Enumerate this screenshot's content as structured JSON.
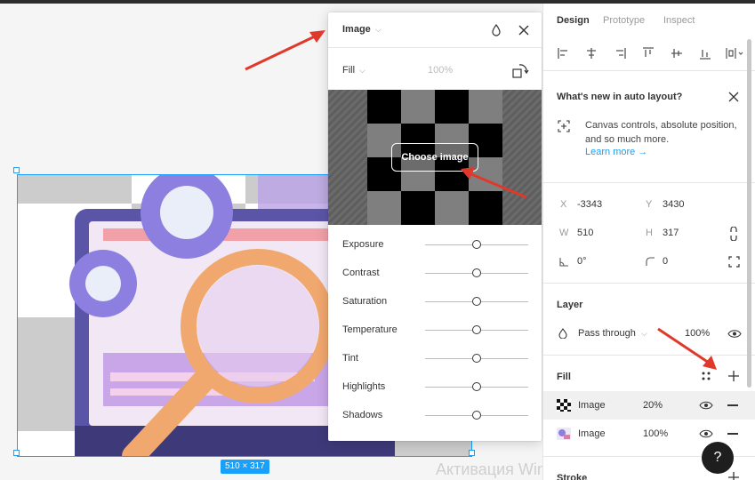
{
  "canvas": {
    "selection_size": "510 × 317",
    "watermark": "Активация Windows"
  },
  "image_popup": {
    "title": "Image",
    "fill_mode": "Fill",
    "opacity": "100%",
    "choose_button": "Choose image",
    "adjustments": [
      {
        "label": "Exposure",
        "value": 0
      },
      {
        "label": "Contrast",
        "value": 0
      },
      {
        "label": "Saturation",
        "value": 0
      },
      {
        "label": "Temperature",
        "value": 0
      },
      {
        "label": "Tint",
        "value": 0
      },
      {
        "label": "Highlights",
        "value": 0
      },
      {
        "label": "Shadows",
        "value": 0
      }
    ]
  },
  "panel": {
    "tabs": [
      "Design",
      "Prototype",
      "Inspect"
    ],
    "active_tab": "Design",
    "whats_new": {
      "title": "What's new in auto layout?",
      "body": "Canvas controls, absolute position, and so much more.",
      "link": "Learn more →"
    },
    "position": {
      "x_label": "X",
      "x": "-3343",
      "y_label": "Y",
      "y": "3430"
    },
    "size": {
      "w_label": "W",
      "w": "510",
      "h_label": "H",
      "h": "317"
    },
    "rotation": "0°",
    "radius": "0",
    "layer": {
      "title": "Layer",
      "blend": "Pass through",
      "opacity": "100%"
    },
    "fill": {
      "title": "Fill",
      "items": [
        {
          "name": "Image",
          "opacity": "20%"
        },
        {
          "name": "Image",
          "opacity": "100%"
        }
      ]
    },
    "stroke": {
      "title": "Stroke"
    }
  },
  "help_button": "?",
  "colors": {
    "accent": "#18a0fb",
    "annotation_arrow": "#e0392b"
  }
}
